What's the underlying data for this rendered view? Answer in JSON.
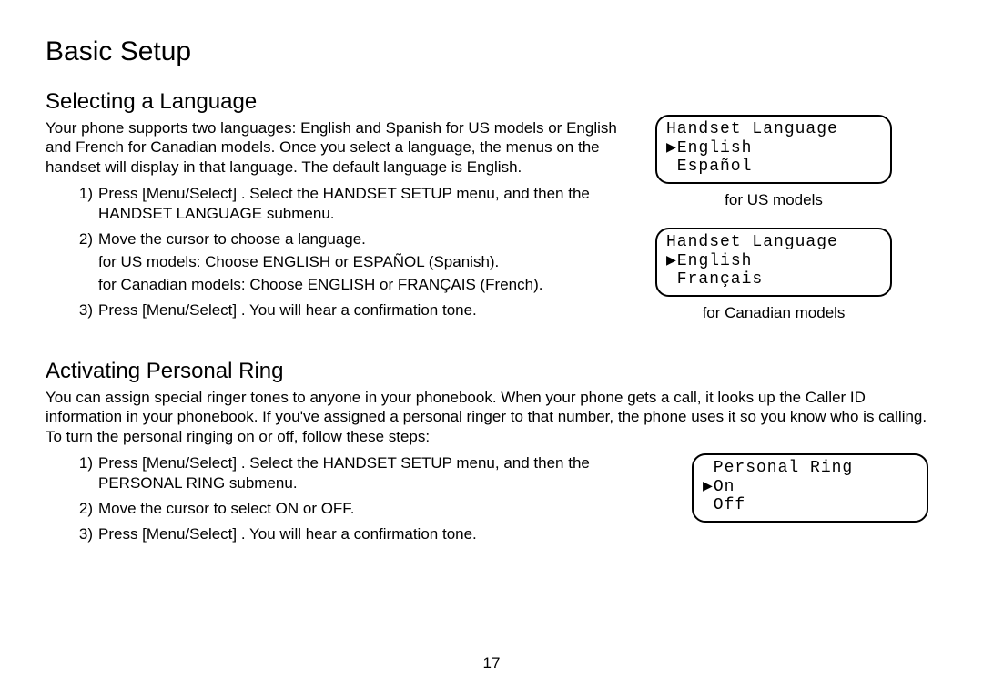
{
  "page_title": "Basic Setup",
  "section1": {
    "heading": "Selecting a Language",
    "intro": "Your phone supports two languages: English and Spanish for US models or English and French for Canadian models. Once you select a language, the menus on the handset will display in that language. The default language is English.",
    "steps": [
      {
        "num": "1)",
        "text": "Press [Menu/Select] . Select the HANDSET SETUP menu, and then the HANDSET LANGUAGE submenu."
      },
      {
        "num": "2)",
        "text": "Move the cursor to choose a language.",
        "sub1": "for US models: Choose ENGLISH or ESPAÑOL (Spanish).",
        "sub2": "for Canadian models: Choose ENGLISH or FRANÇAIS (French)."
      },
      {
        "num": "3)",
        "text": "Press [Menu/Select] . You will hear a confirmation tone."
      }
    ],
    "screen1": {
      "line1": "Handset Language",
      "line2": "▶English",
      "line3": " Español",
      "caption": "for US models"
    },
    "screen2": {
      "line1": "Handset Language",
      "line2": "▶English",
      "line3": " Français",
      "caption": "for Canadian models"
    }
  },
  "section2": {
    "heading": "Activating   Personal Ring",
    "intro": "You can assign special ringer tones to anyone in your phonebook. When your phone gets a call, it looks up the Caller ID information in your phonebook. If you've assigned a personal ringer to that number, the phone uses it so you know who is calling. To turn the personal ringing on or off, follow these steps:",
    "steps": [
      {
        "num": "1)",
        "text": "Press [Menu/Select] . Select the HANDSET SETUP menu, and then the PERSONAL RING submenu."
      },
      {
        "num": "2)",
        "text": "Move the cursor to select ON or OFF."
      },
      {
        "num": "3)",
        "text": "Press [Menu/Select] . You will hear a confirmation tone."
      }
    ],
    "screen": {
      "line1": " Personal Ring",
      "line2": "▶On",
      "line3": " Off"
    }
  },
  "page_number": "17"
}
